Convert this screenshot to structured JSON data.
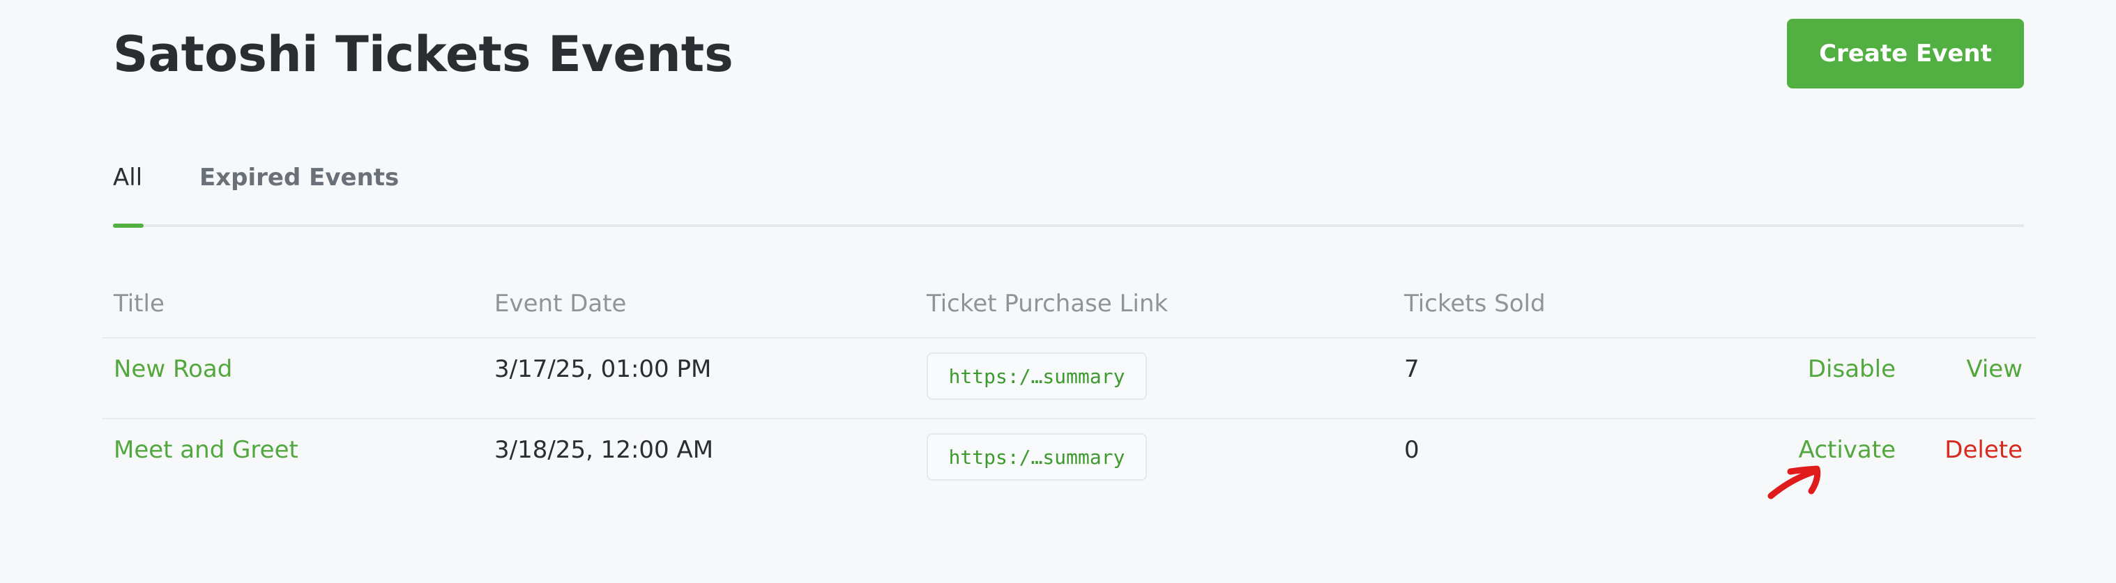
{
  "page": {
    "title": "Satoshi Tickets Events",
    "create_button_label": "Create Event"
  },
  "tabs": [
    {
      "label": "All",
      "active": true
    },
    {
      "label": "Expired Events",
      "active": false
    }
  ],
  "table": {
    "headers": [
      "Title",
      "Event Date",
      "Ticket Purchase Link",
      "Tickets Sold"
    ],
    "rows": [
      {
        "title": "New Road",
        "date": "3/17/25, 01:00 PM",
        "link": "https:/…summary",
        "sold": "7",
        "primary_action": "Disable",
        "secondary_action": "View"
      },
      {
        "title": "Meet and Greet",
        "date": "3/18/25, 12:00 AM",
        "link": "https:/…summary",
        "sold": "0",
        "primary_action": "Activate",
        "secondary_action": "Delete"
      }
    ]
  },
  "colors": {
    "accent_green": "#52b043",
    "link_green": "#52a83f",
    "danger_red": "#d9281e",
    "annotation_red": "#e01b1b"
  },
  "icons": {
    "annotation": "hand-drawn-arrow-icon"
  }
}
